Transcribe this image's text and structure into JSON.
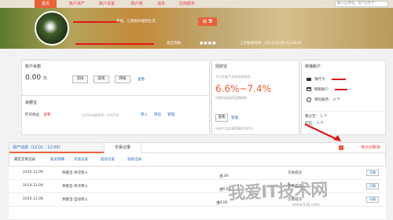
{
  "nav": {
    "items": [
      {
        "label": "首页"
      },
      {
        "label": "账户资产"
      },
      {
        "label": "账户设置"
      },
      {
        "label": "账户通"
      },
      {
        "label": "消息"
      },
      {
        "label": "应用服务"
      }
    ],
    "search_placeholder": "输入应用名，如\"信用卡\""
  },
  "profile": {
    "greeting": "系统，让我帮你理财生活",
    "badge_count": "9",
    "security_label": "安全等级：",
    "security_dots": "●●●●",
    "last_login": "上次登录时间：2014.12.09 11:28:05"
  },
  "balance": {
    "title": "账户余额",
    "amount": "0.00",
    "unit": "元",
    "recharge": "充值",
    "withdraw": "提现",
    "transfer": "转账",
    "view": "查看"
  },
  "yuebao": {
    "title": "余额宝",
    "yesterday_label": "昨日收益",
    "view": "查看",
    "rate": "七日年化收益率：4.037%",
    "transfer_in": "转入",
    "transfer_out": "转出",
    "manage": "管理"
  },
  "zhaocaibao": {
    "title": "招财宝",
    "rate_label": "今日主推产品年化收益率：",
    "rate": "6.6%~7.4%",
    "desc": "可随时变现的定期理财",
    "view": "查看",
    "manage": "管理",
    "history": "历史产品本息保障率100%"
  },
  "bindings": {
    "title": "转播账户",
    "bank": "银行卡",
    "insurance": "网银账户",
    "protect": "保险服务：",
    "protect_count": "0",
    "protect_unit": "个",
    "points_label": "集分宝：",
    "points_value": "1",
    "points_unit": "个",
    "bonus_label": "红包：",
    "bonus_value": "0",
    "bonus_unit": "个"
  },
  "tabs": {
    "active": "资产动态（12.01 - 12.09）",
    "records": "交易记录",
    "ebill": "电子对账单"
  },
  "subnav": [
    "最近交易记录",
    "收支明细",
    "充值记录",
    "提现记录",
    "退款记录"
  ],
  "transactions": [
    {
      "date": "2014.12.09",
      "name": "余额宝-单次转入",
      "amount": "-5.00",
      "unit": "元",
      "status": "交易成功",
      "detail": "详情"
    },
    {
      "date": "2014.12.09",
      "name": "余额宝-单次转入",
      "amount": "-36.00",
      "unit": "元",
      "status": "交易成功",
      "detail": "详情"
    },
    {
      "date": "2014.12.08",
      "name": "余额宝-自动转入",
      "amount": "-90.00",
      "unit": "元",
      "status": "交易成功",
      "detail": "详情"
    }
  ],
  "watermark": {
    "text": "我爱IT技术网",
    "url": "www.52ij.com"
  },
  "colors": {
    "accent": "#e9613b",
    "link": "#2a6bb8",
    "alert": "#e33"
  }
}
